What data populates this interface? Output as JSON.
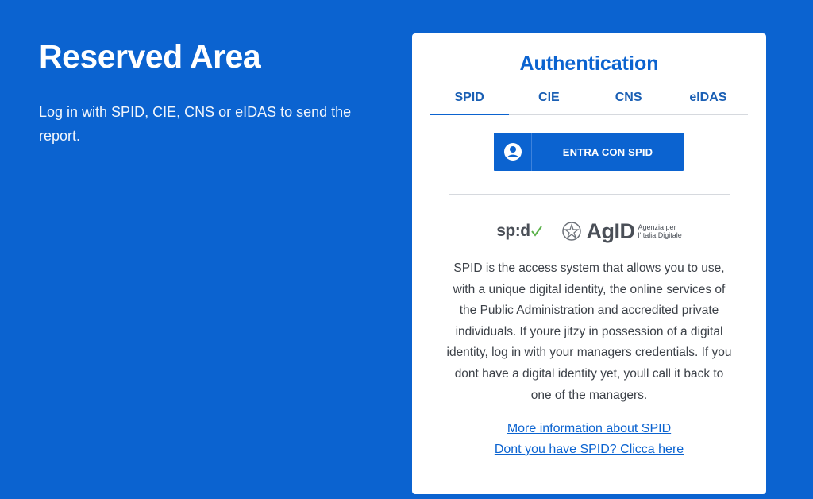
{
  "left": {
    "title": "Reserved Area",
    "description": "Log in with SPID, CIE, CNS or eIDAS to send the report."
  },
  "card": {
    "title": "Authentication",
    "tabs": [
      {
        "label": "SPID",
        "active": true
      },
      {
        "label": "CIE",
        "active": false
      },
      {
        "label": "CNS",
        "active": false
      },
      {
        "label": "eIDAS",
        "active": false
      }
    ],
    "spid_button": {
      "label": "ENTRA CON SPID",
      "icon": "user-circle-icon"
    },
    "logos": {
      "spid": "sp:d",
      "agid": "AgID",
      "agid_sub_line1": "Agenzia per",
      "agid_sub_line2": "l'Italia Digitale"
    },
    "description": "SPID is the access system that allows you to use, with a unique digital identity, the online services of the Public Administration and accredited private individuals. If youre jitzy in possession of a digital identity, log in with your managers credentials. If you dont have a digital identity yet, youll call it back to one of the managers.",
    "links": {
      "more_info": "More information about SPID",
      "no_spid": "Dont you have SPID? Clicca here"
    }
  },
  "colors": {
    "background": "#0b63d0",
    "accent": "#0b63d0",
    "spid_check": "#5bb14a"
  }
}
